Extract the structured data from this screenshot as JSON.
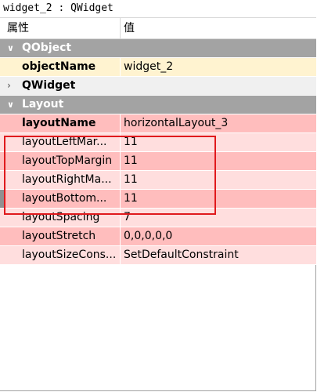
{
  "window": {
    "title": "widget_2 : QWidget"
  },
  "header": {
    "property_col": "属性",
    "value_col": "值"
  },
  "groups": [
    {
      "label": "QObject",
      "expanded": true
    },
    {
      "label": "QWidget",
      "expanded": false
    },
    {
      "label": "Layout",
      "expanded": true
    }
  ],
  "qobject_props": [
    {
      "name": "objectName",
      "value": "widget_2"
    }
  ],
  "layout_props": [
    {
      "name": "layoutName",
      "value": "horizontalLayout_3"
    },
    {
      "name": "layoutLeftMar...",
      "value": "11"
    },
    {
      "name": "layoutTopMargin",
      "value": "11"
    },
    {
      "name": "layoutRightMa...",
      "value": "11"
    },
    {
      "name": "layoutBottom...",
      "value": "11"
    },
    {
      "name": "layoutSpacing",
      "value": "7"
    },
    {
      "name": "layoutStretch",
      "value": "0,0,0,0,0"
    },
    {
      "name": "layoutSizeCons...",
      "value": "SetDefaultConstraint"
    }
  ],
  "colors": {
    "group_header": "#a3a3a3",
    "object_row": "#fff3d0",
    "layout_row_strong": "#ffbdbd",
    "layout_row_light": "#ffdede",
    "highlight_border": "#e0191d"
  },
  "icons": {
    "expanded": "chevron-down-icon",
    "collapsed": "chevron-right-icon"
  }
}
